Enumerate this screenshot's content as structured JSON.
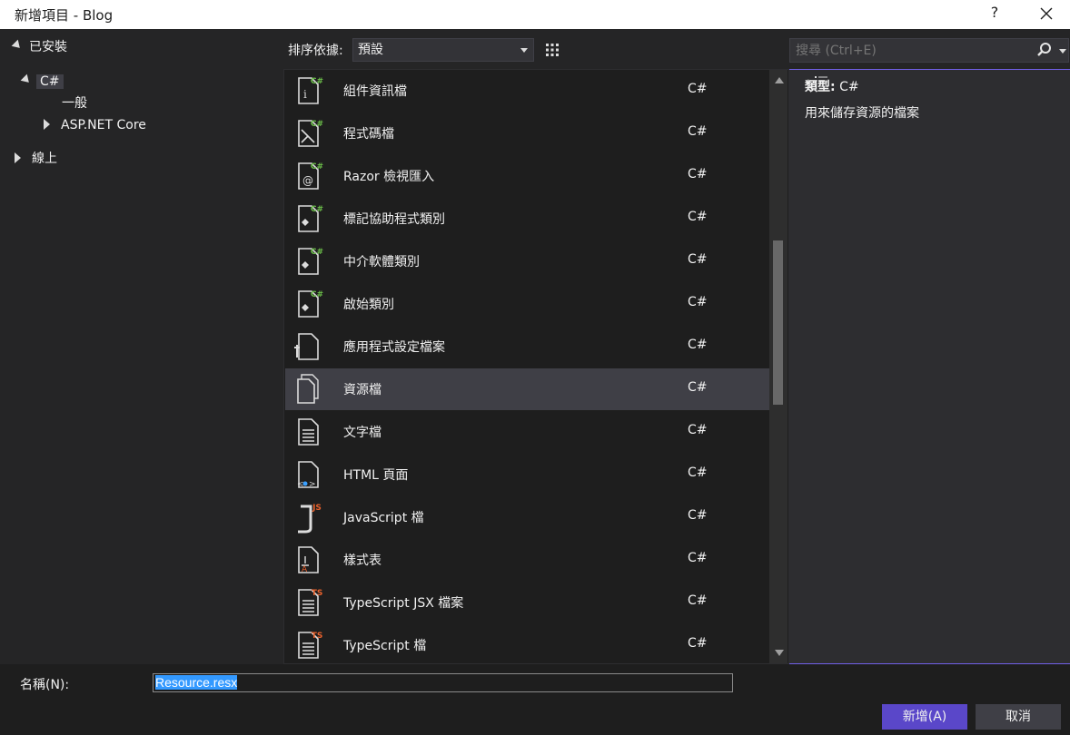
{
  "window": {
    "title": "新增項目 - Blog",
    "help_label": "?"
  },
  "tree": {
    "installed_label": "已安裝",
    "csharp_label": "C#",
    "general_label": "一般",
    "aspnet_label": "ASP.NET Core",
    "online_label": "線上"
  },
  "toolbar": {
    "sort_label": "排序依據:",
    "sort_value": "預設",
    "search_placeholder": "搜尋 (Ctrl+E)"
  },
  "items": [
    {
      "name": "組件資訊檔",
      "lang": "C#",
      "icon": "assembly-info-icon"
    },
    {
      "name": "程式碼檔",
      "lang": "C#",
      "icon": "code-file-icon"
    },
    {
      "name": "Razor 檢視匯入",
      "lang": "C#",
      "icon": "razor-icon"
    },
    {
      "name": "標記協助程式類別",
      "lang": "C#",
      "icon": "tag-helper-icon"
    },
    {
      "name": "中介軟體類別",
      "lang": "C#",
      "icon": "middleware-icon"
    },
    {
      "name": "啟始類別",
      "lang": "C#",
      "icon": "startup-icon"
    },
    {
      "name": "應用程式設定檔案",
      "lang": "C#",
      "icon": "app-settings-icon"
    },
    {
      "name": "資源檔",
      "lang": "C#",
      "icon": "resource-file-icon",
      "selected": true
    },
    {
      "name": "文字檔",
      "lang": "C#",
      "icon": "text-file-icon"
    },
    {
      "name": "HTML 頁面",
      "lang": "C#",
      "icon": "html-page-icon"
    },
    {
      "name": "JavaScript 檔",
      "lang": "C#",
      "icon": "javascript-icon"
    },
    {
      "name": "樣式表",
      "lang": "C#",
      "icon": "stylesheet-icon"
    },
    {
      "name": "TypeScript JSX 檔案",
      "lang": "C#",
      "icon": "typescript-jsx-icon"
    },
    {
      "name": "TypeScript 檔",
      "lang": "C#",
      "icon": "typescript-icon"
    }
  ],
  "details": {
    "type_label": "類型:",
    "type_value": "C#",
    "description": "用來儲存資源的檔案"
  },
  "bottom": {
    "name_label": "名稱(N):",
    "name_value": "Resource.resx",
    "add_label": "新增(A)",
    "cancel_label": "取消"
  },
  "colors": {
    "background": "#252526",
    "list_bg": "#1e1e1e",
    "selected_row": "#3f3f46",
    "primary_button": "#5a47c9",
    "text_selection": "#3399ff",
    "csharp_badge": "#6cc04a",
    "js_badge": "#e8612c",
    "ts_badge": "#e8612c"
  }
}
